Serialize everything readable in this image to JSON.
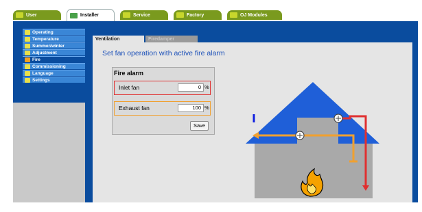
{
  "top_tabs": [
    {
      "label": "User",
      "active": false
    },
    {
      "label": "Installer",
      "active": true
    },
    {
      "label": "Service",
      "active": false
    },
    {
      "label": "Factory",
      "active": false
    },
    {
      "label": "OJ Modules",
      "active": false
    }
  ],
  "sidebar": {
    "items": [
      {
        "label": "Operating"
      },
      {
        "label": "Temperature"
      },
      {
        "label": "Summer/winter"
      },
      {
        "label": "Adjustment"
      },
      {
        "label": "Fire"
      },
      {
        "label": "Commissioning"
      },
      {
        "label": "Language"
      },
      {
        "label": "Settings"
      }
    ],
    "active_index": 4
  },
  "sub_tabs": [
    {
      "label": "Ventilation",
      "active": true
    },
    {
      "label": "Firedamper",
      "active": false
    }
  ],
  "page_heading": "Set fan operation with active fire alarm",
  "fire_alarm": {
    "title": "Fire alarm",
    "inlet_fan": {
      "label": "Inlet fan",
      "value": "0",
      "unit": "%"
    },
    "exhaust_fan": {
      "label": "Exhaust fan",
      "value": "100",
      "unit": "%"
    },
    "save_label": "Save"
  },
  "colors": {
    "accent_blue": "#0a4c9e",
    "tab_green": "#7a9a1e",
    "inlet_border": "#e03030",
    "exhaust_border": "#f0a030",
    "roof": "#1f5fd8",
    "house": "#a9a9a9"
  }
}
